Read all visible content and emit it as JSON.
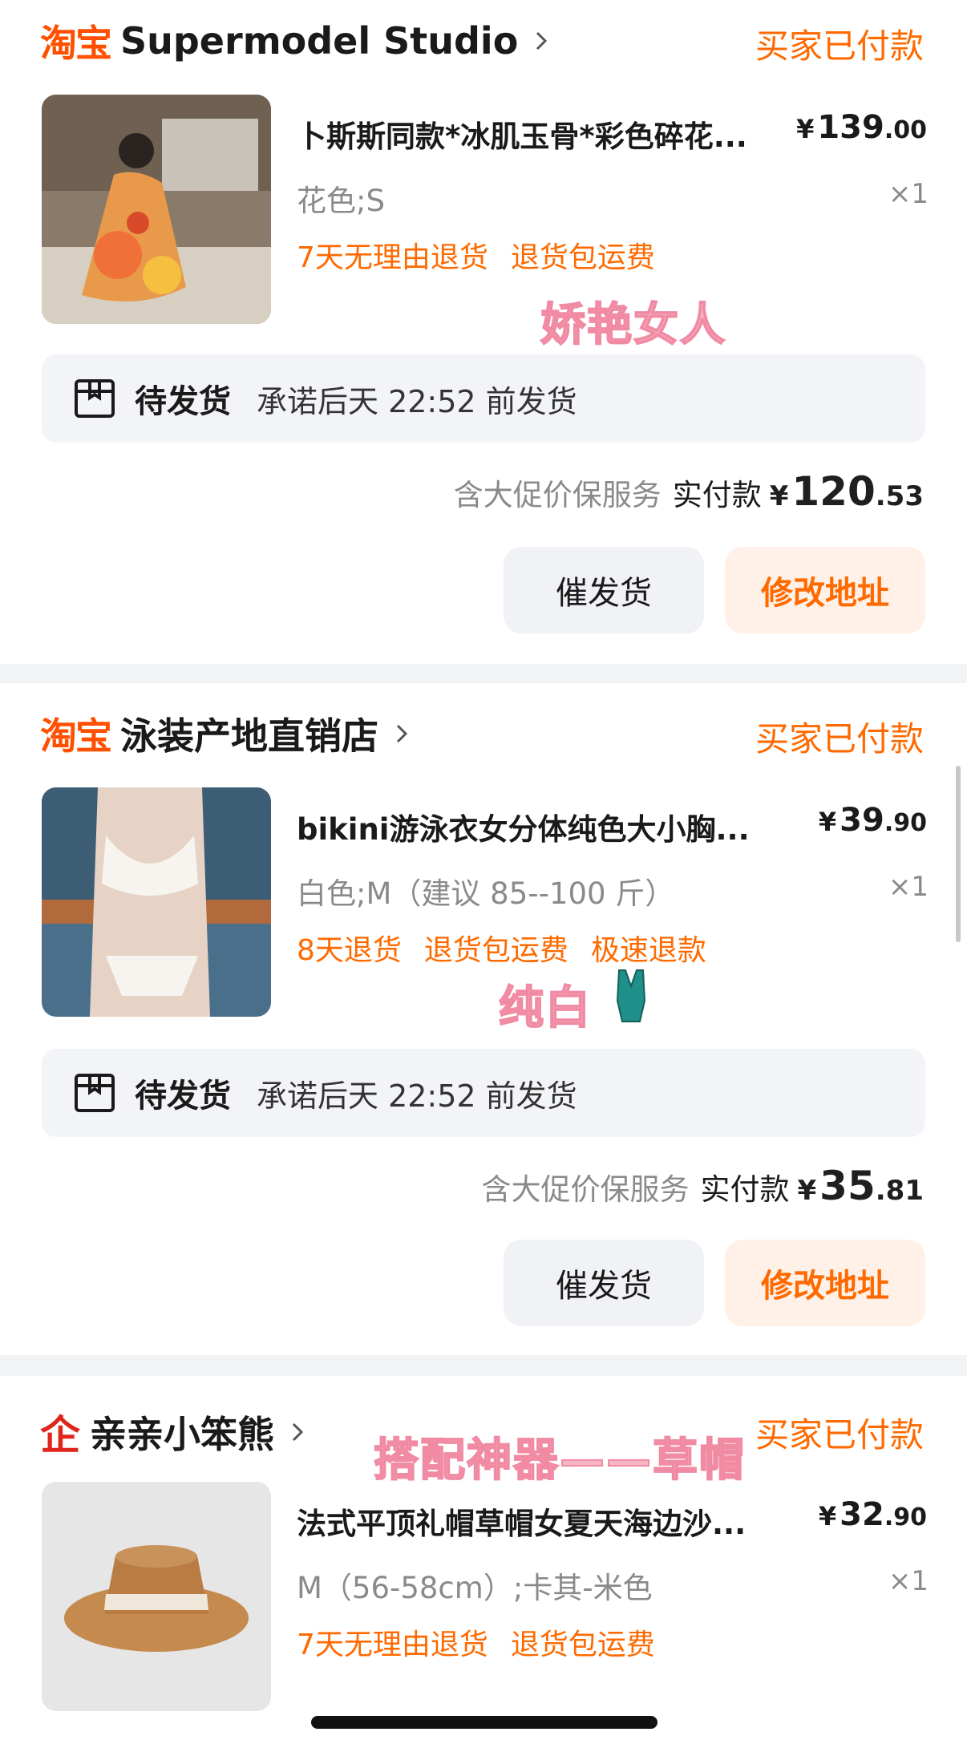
{
  "orders": [
    {
      "platform": "淘宝",
      "shop": "Supermodel Studio",
      "status": "买家已付款",
      "title": "卜斯斯同款*冰肌玉骨*彩色碎花...",
      "price_int": "139",
      "price_dec": ".00",
      "variant": "花色;S",
      "qty": "×1",
      "tags": [
        "7天无理由退货",
        "退货包运费"
      ],
      "sticker": "娇艳女人",
      "ship_status": "待发货",
      "ship_promise": "承诺后天 22:52 前发货",
      "service": "含大促价保服务",
      "paid_label": "实付款",
      "paid_int": "120",
      "paid_dec": ".53",
      "btn_urge": "催发货",
      "btn_address": "修改地址"
    },
    {
      "platform": "淘宝",
      "shop": "泳装产地直销店",
      "status": "买家已付款",
      "title": "bikini游泳衣女分体纯色大小胸...",
      "price_int": "39",
      "price_dec": ".90",
      "variant": "白色;M（建议 85--100 斤）",
      "qty": "×1",
      "tags": [
        "8天退货",
        "退货包运费",
        "极速退款"
      ],
      "sticker": "纯白",
      "ship_status": "待发货",
      "ship_promise": "承诺后天 22:52 前发货",
      "service": "含大促价保服务",
      "paid_label": "实付款",
      "paid_int": "35",
      "paid_dec": ".81",
      "btn_urge": "催发货",
      "btn_address": "修改地址"
    },
    {
      "platform": "企",
      "shop": "亲亲小笨熊",
      "status": "买家已付款",
      "title": "法式平顶礼帽草帽女夏天海边沙...",
      "price_int": "32",
      "price_dec": ".90",
      "variant": "M（56-58cm）;卡其-米色",
      "qty": "×1",
      "tags": [
        "7天无理由退货",
        "退货包运费"
      ],
      "sticker": "搭配神器——草帽"
    }
  ],
  "currency": "¥",
  "colors": {
    "accent": "#ff6a00",
    "taobao": "#ff5000",
    "sticker": "#f7b6c4"
  }
}
